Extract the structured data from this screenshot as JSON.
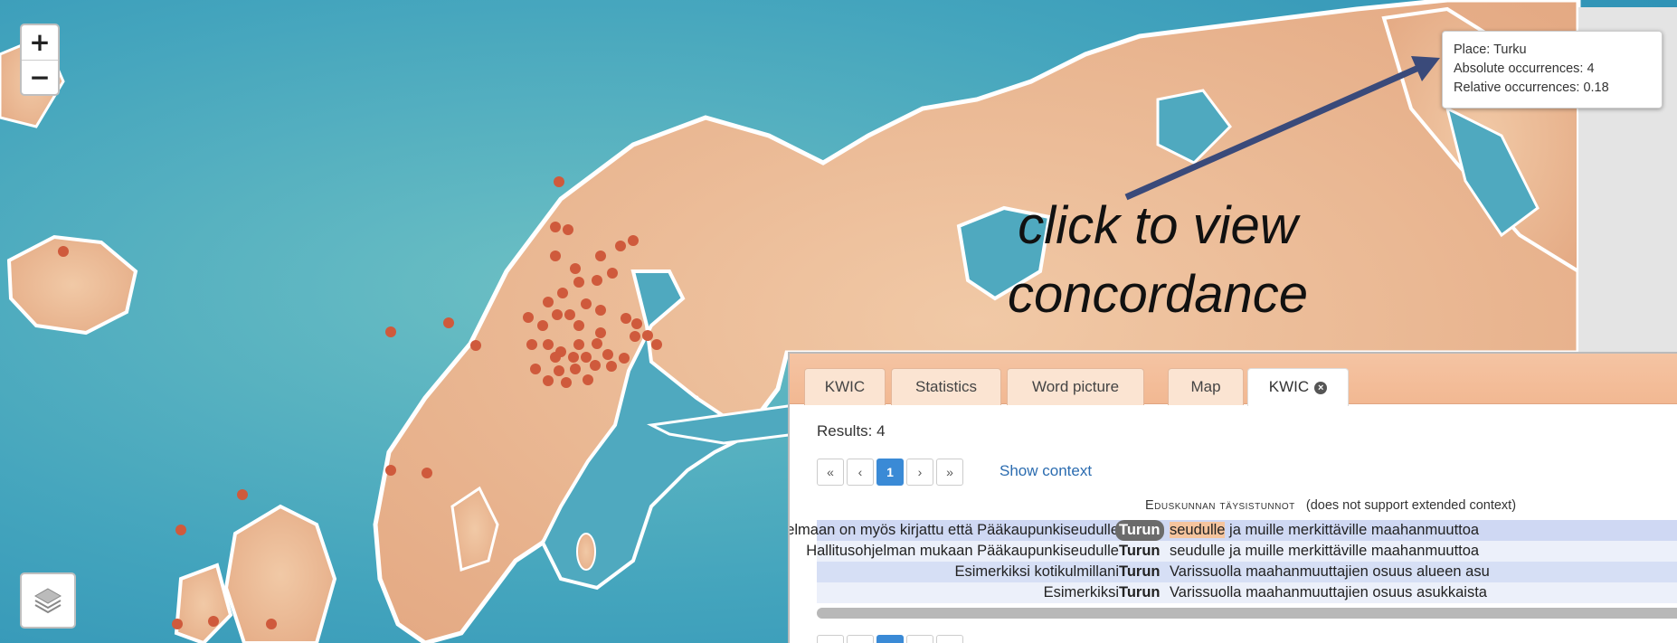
{
  "map": {
    "zoom_in": "+",
    "zoom_out": "−",
    "layers_icon": "layers-icon",
    "ocean_color": "#4aaab8",
    "land_color": "#eab590",
    "point_color": "#cf5a3c"
  },
  "tooltip": {
    "place": "Place: Turku",
    "absolute": "Absolute occurrences: 4",
    "relative": "Relative occurrences: 0.18"
  },
  "annotation": {
    "line1": "click to view",
    "line2": "concordance"
  },
  "panel": {
    "tabs": [
      {
        "label": "KWIC"
      },
      {
        "label": "Statistics"
      },
      {
        "label": "Word picture"
      },
      {
        "label": "Map"
      },
      {
        "label": "KWIC",
        "close_icon": "close-circle-icon"
      }
    ],
    "results_label": "Results: 4",
    "pager": {
      "first": "«",
      "prev": "‹",
      "current": "1",
      "next": "›",
      "last": "»"
    },
    "show_context": "Show context",
    "corpus_name": "Eduskunnan täysistunnot",
    "corpus_note": "(does not support extended context)",
    "rows": [
      {
        "left": "Hallitusohjelmaan on myös kirjattu että Pääkaupunkiseudulle",
        "match": "Turun",
        "right_hl": "seudulle",
        "right": " ja muille merkittäville maahanmuuttoa"
      },
      {
        "left": "Hallitusohjelman mukaan Pääkaupunkiseudulle",
        "match": "Turun",
        "right_hl": "",
        "right": "seudulle ja muille merkittäville maahanmuuttoa"
      },
      {
        "left": "Esimerkiksi kotikulmillani",
        "match": "Turun",
        "right_hl": "",
        "right": "Varissuolla maahanmuuttajien osuus alueen asu"
      },
      {
        "left": "Esimerkiksi",
        "match": "Turun",
        "right_hl": "",
        "right": "Varissuolla maahanmuuttajien osuus asukkaista"
      }
    ]
  }
}
